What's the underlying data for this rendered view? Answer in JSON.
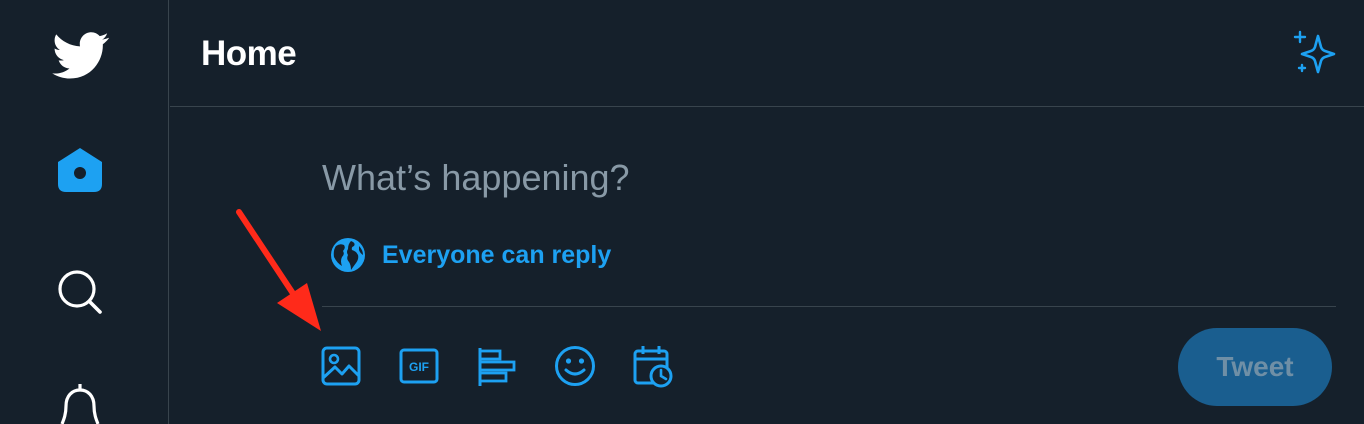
{
  "header": {
    "title": "Home"
  },
  "composer": {
    "placeholder": "What’s happening?",
    "reply_setting": "Everyone can reply",
    "tweet_button": "Tweet",
    "toolbar_icons": [
      "image-icon",
      "gif-icon",
      "poll-icon",
      "emoji-icon",
      "schedule-icon"
    ]
  },
  "sidebar": {
    "icons": [
      "twitter-logo-icon",
      "home-icon",
      "search-icon",
      "notifications-bell-icon"
    ]
  },
  "colors": {
    "background": "#15202b",
    "accent": "#1da1f2",
    "border": "#38444d",
    "placeholder": "#8899a6",
    "tweet_button_disabled": "#1a5e8f",
    "annotation_arrow": "#ff2a1a"
  }
}
